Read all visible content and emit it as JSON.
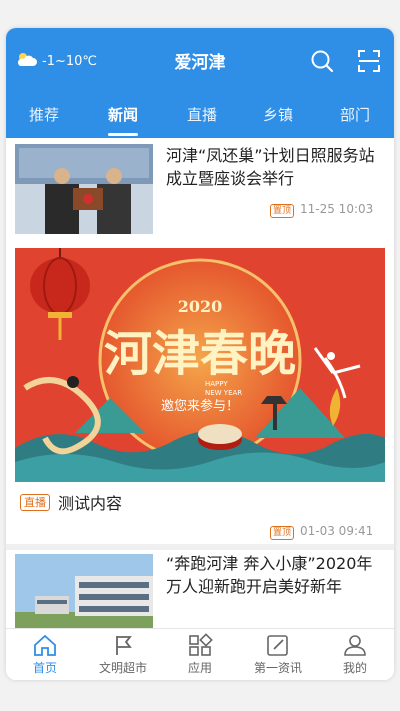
{
  "header": {
    "weather": "-1~10℃",
    "title": "爱河津",
    "icons": [
      "sun-cloud-icon",
      "search-icon",
      "scan-icon"
    ]
  },
  "tabs": [
    {
      "label": "推荐"
    },
    {
      "label": "新闻",
      "active": true
    },
    {
      "label": "直播"
    },
    {
      "label": "乡镇"
    },
    {
      "label": "部门"
    }
  ],
  "feed": {
    "item1": {
      "title": "河津“凤还巢”计划日照服务站成立暨座谈会举行",
      "tag": "置顶",
      "time": "11-25 10:03"
    },
    "banner": {
      "year": "2020",
      "headline": "河津春晚",
      "sub_en1": "HAPPY",
      "sub_en2": "NEW YEAR",
      "invite": "邀您来参与！"
    },
    "item2": {
      "live_tag": "直播",
      "title": "测试内容",
      "tag": "置顶",
      "time": "01-03 09:41"
    },
    "item3": {
      "title": "“奔跑河津 奔入小康”2020年万人迎新跑开启美好新年"
    }
  },
  "bottom_nav": [
    {
      "label": "首页",
      "icon": "home-icon",
      "active": true
    },
    {
      "label": "文明超市",
      "icon": "flag-icon"
    },
    {
      "label": "应用",
      "icon": "apps-icon"
    },
    {
      "label": "第一资讯",
      "icon": "edit-icon"
    },
    {
      "label": "我的",
      "icon": "user-icon"
    }
  ],
  "colors": {
    "accent": "#2f8ee6",
    "tag": "#e0701e"
  }
}
